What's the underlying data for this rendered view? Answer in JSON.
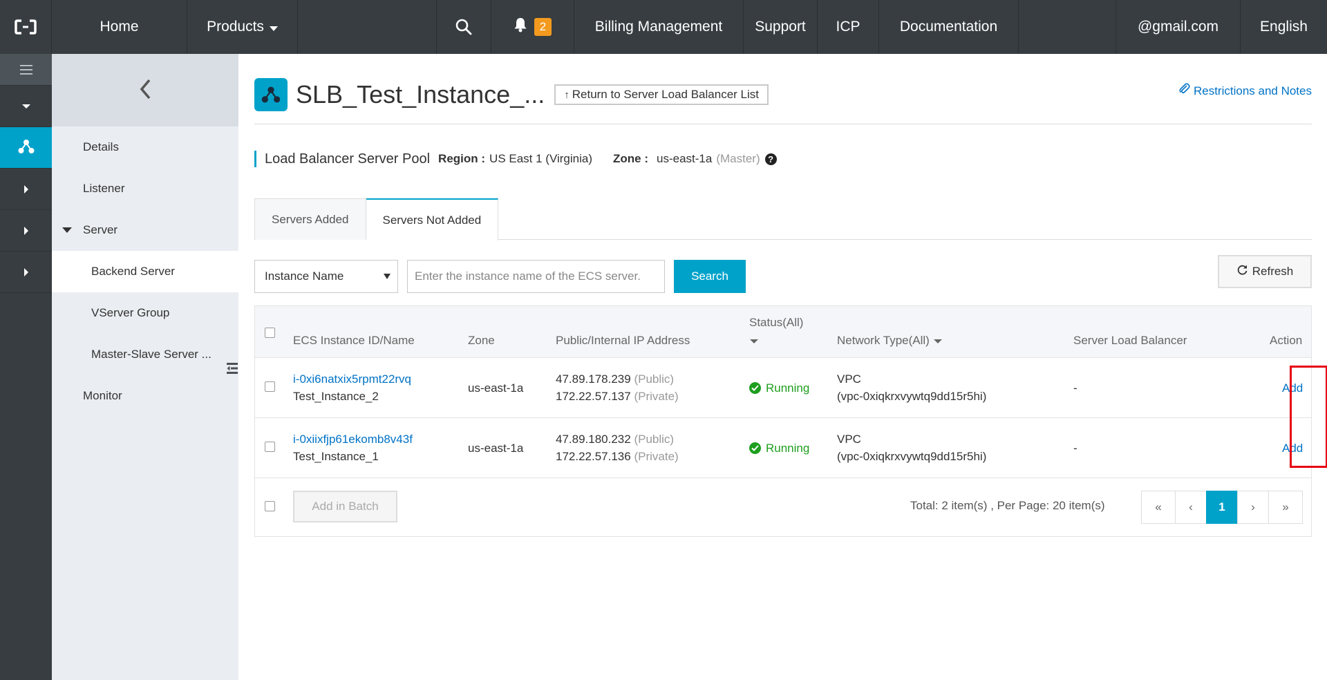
{
  "topnav": {
    "home": "Home",
    "products": "Products",
    "notification_count": "2",
    "billing": "Billing Management",
    "support": "Support",
    "icp": "ICP",
    "documentation": "Documentation",
    "account": "@gmail.com",
    "language": "English"
  },
  "subnav": {
    "items": [
      {
        "label": "Details"
      },
      {
        "label": "Listener"
      },
      {
        "label": "Server"
      },
      {
        "label": "Backend Server"
      },
      {
        "label": "VServer Group"
      },
      {
        "label": "Master-Slave Server ..."
      },
      {
        "label": "Monitor"
      }
    ]
  },
  "header": {
    "title": "SLB_Test_Instance_...",
    "return_label": "Return to Server Load Balancer List",
    "restrictions_label": "Restrictions and Notes"
  },
  "pool": {
    "title": "Load Balancer Server Pool",
    "region_label": "Region :",
    "region_value": "US East 1 (Virginia)",
    "zone_label": "Zone :",
    "zone_value": "us-east-1a",
    "zone_role": "(Master)"
  },
  "tabs": [
    {
      "label": "Servers Added"
    },
    {
      "label": "Servers Not Added"
    }
  ],
  "search": {
    "filter_selected": "Instance Name",
    "placeholder": "Enter the instance name of the ECS server.",
    "button": "Search",
    "refresh": "Refresh"
  },
  "table": {
    "columns": {
      "instance": "ECS Instance ID/Name",
      "zone": "Zone",
      "ip": "Public/Internal IP Address",
      "status": "Status(All)",
      "network": "Network Type(All)",
      "slb": "Server Load Balancer",
      "action": "Action"
    },
    "rows": [
      {
        "id": "i-0xi6natxix5rpmt22rvq",
        "name": "Test_Instance_2",
        "zone": "us-east-1a",
        "public_ip": "47.89.178.239",
        "public_tag": "(Public)",
        "private_ip": "172.22.57.137",
        "private_tag": "(Private)",
        "status": "Running",
        "network_type": "VPC",
        "vpc": "(vpc-0xiqkrxvywtq9dd15r5hi)",
        "slb": "-",
        "action": "Add"
      },
      {
        "id": "i-0xiixfjp61ekomb8v43f",
        "name": "Test_Instance_1",
        "zone": "us-east-1a",
        "public_ip": "47.89.180.232",
        "public_tag": "(Public)",
        "private_ip": "172.22.57.136",
        "private_tag": "(Private)",
        "status": "Running",
        "network_type": "VPC",
        "vpc": "(vpc-0xiqkrxvywtq9dd15r5hi)",
        "slb": "-",
        "action": "Add"
      }
    ],
    "batch_button": "Add in Batch",
    "total_text": "Total: 2 item(s) ,  Per Page: 20 item(s)"
  },
  "pagination": {
    "first": "«",
    "prev": "‹",
    "current": "1",
    "next": "›",
    "last": "»"
  },
  "colors": {
    "topbar": "#373d41",
    "accent": "#00a2ca",
    "link": "#0072c6",
    "running": "#1e9e1e",
    "badge": "#f39a1f",
    "highlight": "#e60012"
  },
  "icons": [
    "console-logo-icon",
    "search-icon",
    "bell-icon",
    "menu-icon",
    "slb-icon",
    "back-chevron-icon",
    "paperclip-icon",
    "help-icon",
    "refresh-icon",
    "check-circle-icon"
  ]
}
